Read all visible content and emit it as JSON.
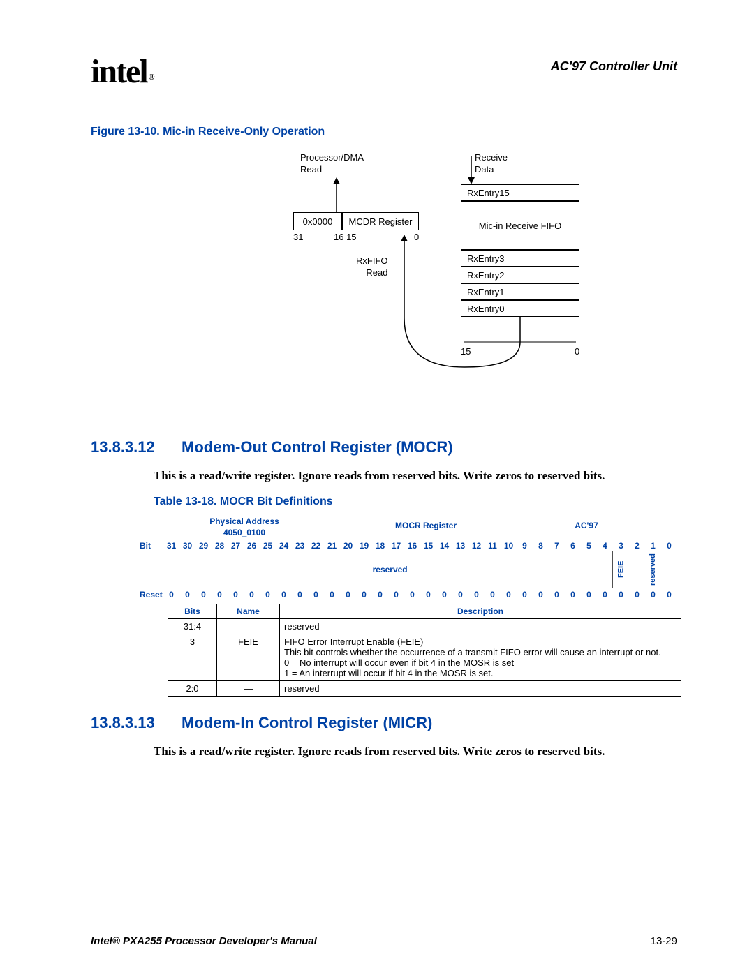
{
  "header": {
    "logo_text": "intel",
    "reg_mark": "®",
    "chapter": "AC'97 Controller Unit"
  },
  "figure": {
    "caption": "Figure 13-10. Mic-in Receive-Only Operation",
    "labels": {
      "proc_dma": "Processor/DMA\nRead",
      "receive_data": "Receive\nData",
      "zero_x": "0x0000",
      "mcdr": "MCDR Register",
      "bit31": "31",
      "bit16_15": "16 15",
      "bit0": "0",
      "rxfifo_read": "RxFIFO\nRead",
      "rxentry15": "RxEntry15",
      "micin_fifo": "Mic-in Receive FIFO",
      "rxentry3": "RxEntry3",
      "rxentry2": "RxEntry2",
      "rxentry1": "RxEntry1",
      "rxentry0": "RxEntry0",
      "bit15": "15",
      "bit0_b": "0"
    }
  },
  "section12": {
    "num": "13.8.3.12",
    "title": "Modem-Out Control Register (MOCR)",
    "body": "This is a read/write register. Ignore reads from reserved bits. Write zeros to reserved bits."
  },
  "table18": {
    "caption": "Table 13-18. MOCR Bit Definitions",
    "phys_addr_label": "Physical Address",
    "phys_addr_val": "4050_0100",
    "reg_name": "MOCR Register",
    "unit": "AC'97",
    "bit_label": "Bit",
    "reset_label": "Reset",
    "bits": [
      "31",
      "30",
      "29",
      "28",
      "27",
      "26",
      "25",
      "24",
      "23",
      "22",
      "21",
      "20",
      "19",
      "18",
      "17",
      "16",
      "15",
      "14",
      "13",
      "12",
      "11",
      "10",
      "9",
      "8",
      "7",
      "6",
      "5",
      "4",
      "3",
      "2",
      "1",
      "0"
    ],
    "resets": [
      "0",
      "0",
      "0",
      "0",
      "0",
      "0",
      "0",
      "0",
      "0",
      "0",
      "0",
      "0",
      "0",
      "0",
      "0",
      "0",
      "0",
      "0",
      "0",
      "0",
      "0",
      "0",
      "0",
      "0",
      "0",
      "0",
      "0",
      "0",
      "0",
      "0",
      "0",
      "0"
    ],
    "field_reserved": "reserved",
    "field_feie": "FEIE",
    "cols": {
      "bits": "Bits",
      "name": "Name",
      "desc": "Description"
    },
    "rows": [
      {
        "bits": "31:4",
        "name": "—",
        "desc": "reserved"
      },
      {
        "bits": "3",
        "name": "FEIE",
        "desc": "FIFO Error Interrupt Enable (FEIE)\nThis bit controls whether the occurrence of a transmit FIFO error will cause an interrupt or not.\n0 =  No interrupt will occur even if bit 4 in the MOSR is set\n1 =  An interrupt will occur if bit 4 in the MOSR is set."
      },
      {
        "bits": "2:0",
        "name": "—",
        "desc": "reserved"
      }
    ]
  },
  "section13": {
    "num": "13.8.3.13",
    "title": "Modem-In Control Register (MICR)",
    "body": "This is a read/write register. Ignore reads from reserved bits. Write zeros to reserved bits."
  },
  "footer": {
    "manual": "Intel® PXA255 Processor Developer's Manual",
    "page": "13-29"
  }
}
